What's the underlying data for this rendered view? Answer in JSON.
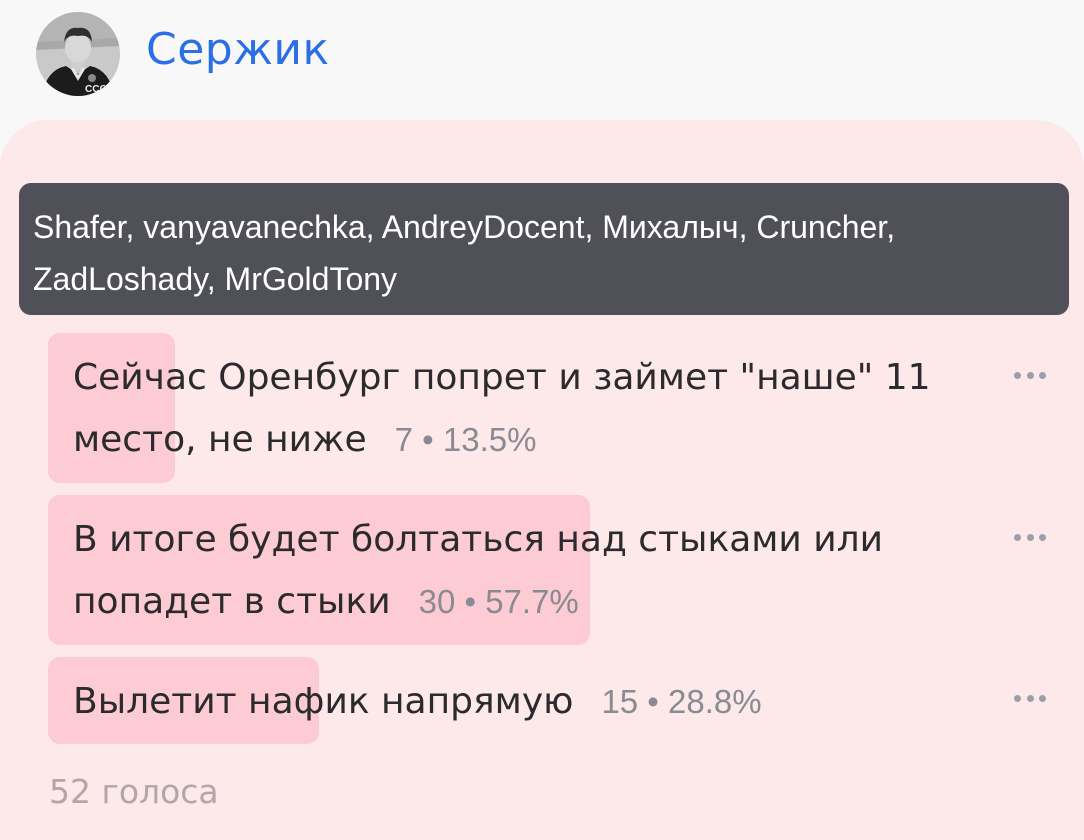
{
  "post": {
    "author_name": "Сержик",
    "avatar_badge": "СССР"
  },
  "poll": {
    "voters": "Shafer, vanyavanechka, AndreyDocent, Михалыч, Cruncher, ZadLoshady, MrGoldTony",
    "options": [
      {
        "label": "Сейчас Оренбург попрет и займет \"наше\" 11 место, не ниже",
        "stats": "7 • 13.5%",
        "percent": 13.5
      },
      {
        "label": "В итоге будет болтаться над стыками или попадет в стыки",
        "stats": "30 • 57.7%",
        "percent": 57.7
      },
      {
        "label": "Вылетит нафик напрямую",
        "stats": "15 • 28.8%",
        "percent": 28.8
      }
    ],
    "total_votes": "52 голоса"
  },
  "colors": {
    "author": "#2a6fe6",
    "card_background": "#fde8ea",
    "option_fill": "#fccbd3",
    "voters_background": "#505058"
  },
  "icons": {
    "avatar": "user-photo-avatar",
    "option_menu": "more-dots-icon"
  }
}
